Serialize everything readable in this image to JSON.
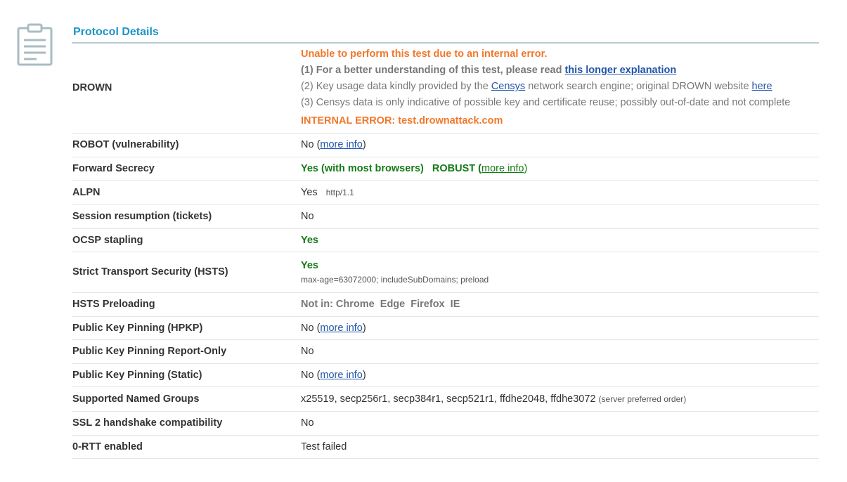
{
  "section": {
    "title": "Protocol Details",
    "icon": "clipboard-icon"
  },
  "drown": {
    "label": "DROWN",
    "error_title": "Unable to perform this test due to an internal error.",
    "note1_prefix": "(1) For a better understanding of this test, please read ",
    "note1_link": "this longer explanation",
    "note2_prefix": "(2) Key usage data kindly provided by the ",
    "note2_link": "Censys",
    "note2_mid": " network search engine; original DROWN website ",
    "note2_link2": "here",
    "note3": "(3) Censys data is only indicative of possible key and certificate reuse; possibly out-of-date and not complete",
    "internal_error": "INTERNAL ERROR: test.drownattack.com"
  },
  "robot": {
    "label": "ROBOT (vulnerability)",
    "value": "No (",
    "link": "more info",
    "suffix": ")"
  },
  "forward_secrecy": {
    "label": "Forward Secrecy",
    "value": "Yes (with most browsers)   ROBUST (",
    "link": "more info",
    "suffix": ")"
  },
  "alpn": {
    "label": "ALPN",
    "value": "Yes",
    "detail": "http/1.1"
  },
  "session_resumption": {
    "label": "Session resumption (tickets)",
    "value": "No"
  },
  "ocsp": {
    "label": "OCSP stapling",
    "value": "Yes"
  },
  "hsts": {
    "label": "Strict Transport Security (HSTS)",
    "value": "Yes",
    "detail": "max-age=63072000; includeSubDomains; preload"
  },
  "hsts_preloading": {
    "label": "HSTS Preloading",
    "value": "Not in: Chrome  Edge  Firefox  IE"
  },
  "hpkp": {
    "label": "Public Key Pinning (HPKP)",
    "value": "No (",
    "link": "more info",
    "suffix": ")"
  },
  "hpkp_report": {
    "label": "Public Key Pinning Report-Only",
    "value": "No"
  },
  "hpkp_static": {
    "label": "Public Key Pinning (Static)",
    "value": "No (",
    "link": "more info",
    "suffix": ")"
  },
  "named_groups": {
    "label": "Supported Named Groups",
    "value": "x25519, secp256r1, secp384r1, secp521r1, ffdhe2048, ffdhe3072",
    "detail": "(server preferred order)"
  },
  "ssl2": {
    "label": "SSL 2 handshake compatibility",
    "value": "No"
  },
  "zero_rtt": {
    "label": "0-RTT enabled",
    "value": "Test failed"
  },
  "colors": {
    "title": "#1e94c8",
    "good": "#137b17",
    "warning": "#f1782a",
    "link": "#2255aa"
  }
}
